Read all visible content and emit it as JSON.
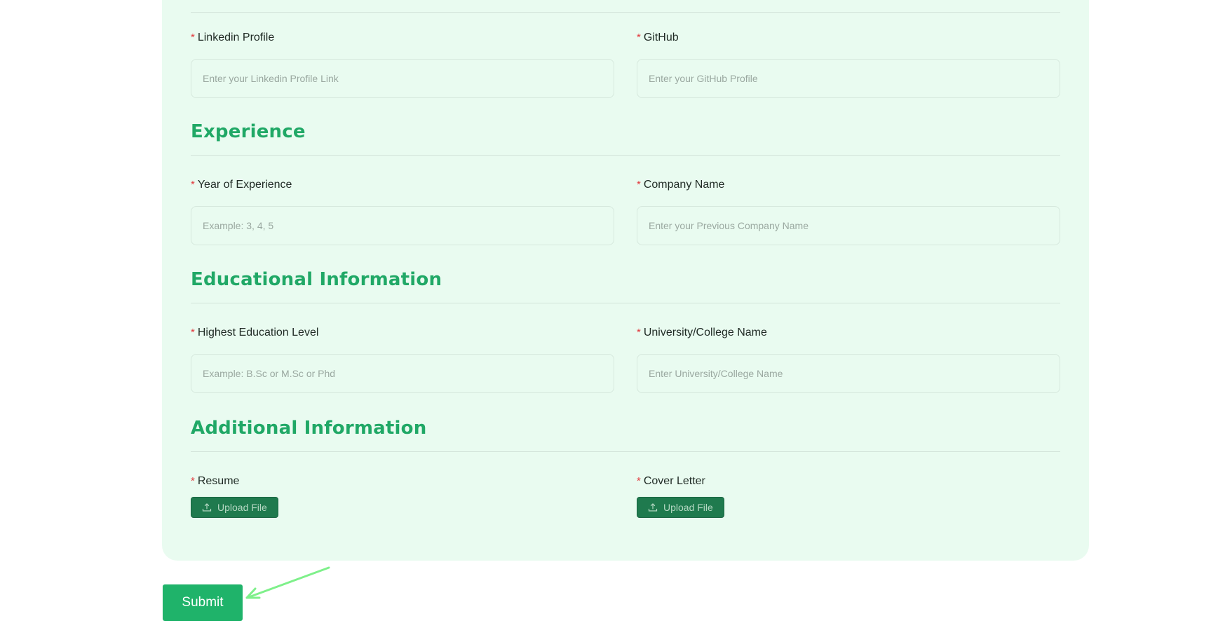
{
  "form": {
    "social": {
      "linkedin": {
        "label": "Linkedin Profile",
        "required_mark": "*",
        "placeholder": "Enter your Linkedin Profile Link",
        "value": ""
      },
      "github": {
        "label": "GitHub",
        "required_mark": "*",
        "placeholder": "Enter your GitHub Profile",
        "value": ""
      }
    },
    "experience": {
      "title": "Experience",
      "years": {
        "label": "Year of Experience",
        "required_mark": "*",
        "placeholder": "Example: 3, 4, 5",
        "value": ""
      },
      "company": {
        "label": "Company Name",
        "required_mark": "*",
        "placeholder": "Enter your Previous Company Name",
        "value": ""
      }
    },
    "education": {
      "title": "Educational Information",
      "level": {
        "label": "Highest Education Level",
        "required_mark": "*",
        "placeholder": "Example: B.Sc or M.Sc or Phd",
        "value": ""
      },
      "university": {
        "label": "University/College Name",
        "required_mark": "*",
        "placeholder": "Enter University/College Name",
        "value": ""
      }
    },
    "additional": {
      "title": "Additional Information",
      "resume": {
        "label": "Resume",
        "required_mark": "*",
        "button_label": "Upload File",
        "icon": "upload-icon"
      },
      "cover_letter": {
        "label": "Cover Letter",
        "required_mark": "*",
        "button_label": "Upload File",
        "icon": "upload-icon"
      }
    }
  },
  "submit": {
    "label": "Submit"
  },
  "colors": {
    "card_background": "#e9fbf0",
    "heading": "#20a866",
    "required": "#e2383c",
    "upload_button": "#1f7a4e",
    "submit_button": "#1fb36a",
    "annotation_arrow": "#7ef08a"
  }
}
